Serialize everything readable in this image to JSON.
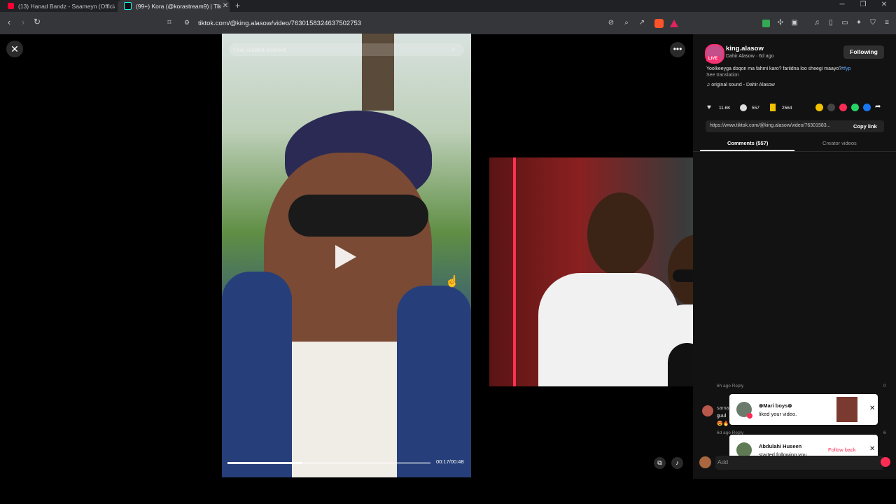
{
  "browser": {
    "tabs": [
      {
        "title": "(13) Hanad Bandz - Saameyn (Official",
        "active": false
      },
      {
        "title": "(99+) Kora (@korastream9) | TikT",
        "active": true
      }
    ],
    "new_tab": "+",
    "url": "tiktok.com/@king.alasow/video/7630158324637502753",
    "window_controls": [
      "minimize",
      "restore",
      "close"
    ]
  },
  "video": {
    "search_placeholder": "Find related content",
    "time": "00:17/00:48",
    "progress": 0.37
  },
  "post": {
    "username": "king.alasow",
    "live_label": "LIVE",
    "author_meta": "Dahir Alasow · 6d ago",
    "follow_label": "Following",
    "caption": "Yoolkeeyga doqon ma fahmi karo? fariidna loo sheegi maayo?",
    "hashtag": "#fyp",
    "see_translation": "See translation",
    "sound": "original sound - Dahir Alasow",
    "likes": "11.6K",
    "comments": "557",
    "saves": "2564",
    "share_url": "https://www.tiktok.com/@king.alasow/video/76301583...",
    "copy_link": "Copy link"
  },
  "side_tabs": {
    "comments": "Comments (557)",
    "creator": "Creator videos"
  },
  "comments_peek": {
    "meta_top": "6h ago   Reply",
    "count_top": "0",
    "name_frag": "sama",
    "text_frag": "guul",
    "meta": "6d ago   Reply",
    "likes": "6"
  },
  "notifications": [
    {
      "name": "⊛Mari boys⊛",
      "text": "liked your video."
    },
    {
      "name": "Abdulahi Huseen",
      "text": "started following you.",
      "action": "Follow back"
    }
  ],
  "add_comment_placeholder": "Add"
}
